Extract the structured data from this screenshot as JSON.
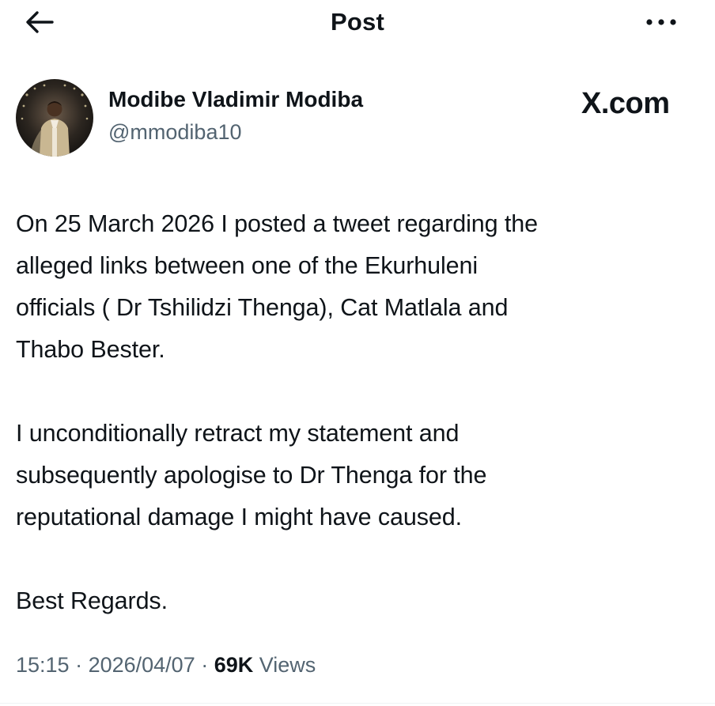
{
  "header": {
    "title": "Post",
    "back_icon": "arrow-left-icon",
    "more_icon": "more-horizontal-icon"
  },
  "author": {
    "display_name": "Modibe Vladimir Modiba",
    "handle": "@mmodiba10",
    "avatar_icon": "profile-photo"
  },
  "watermark": "X.com",
  "tweet": {
    "paragraphs": [
      "On 25 March 2026 I posted a tweet regarding the\nalleged links between one of the Ekurhuleni\nofficials ( Dr Tshilidzi Thenga), Cat Matlala and\nThabo Bester.",
      "I unconditionally retract my statement and\nsubsequently apologise to Dr Thenga for the\nreputational damage I might have caused.",
      "Best Regards."
    ]
  },
  "meta": {
    "time": "15:15",
    "separator": " · ",
    "date": "2026/04/07",
    "views_count": "69K",
    "views_label": "Views"
  },
  "colors": {
    "text_primary": "#0f1419",
    "text_secondary": "#536471",
    "background": "#ffffff"
  }
}
